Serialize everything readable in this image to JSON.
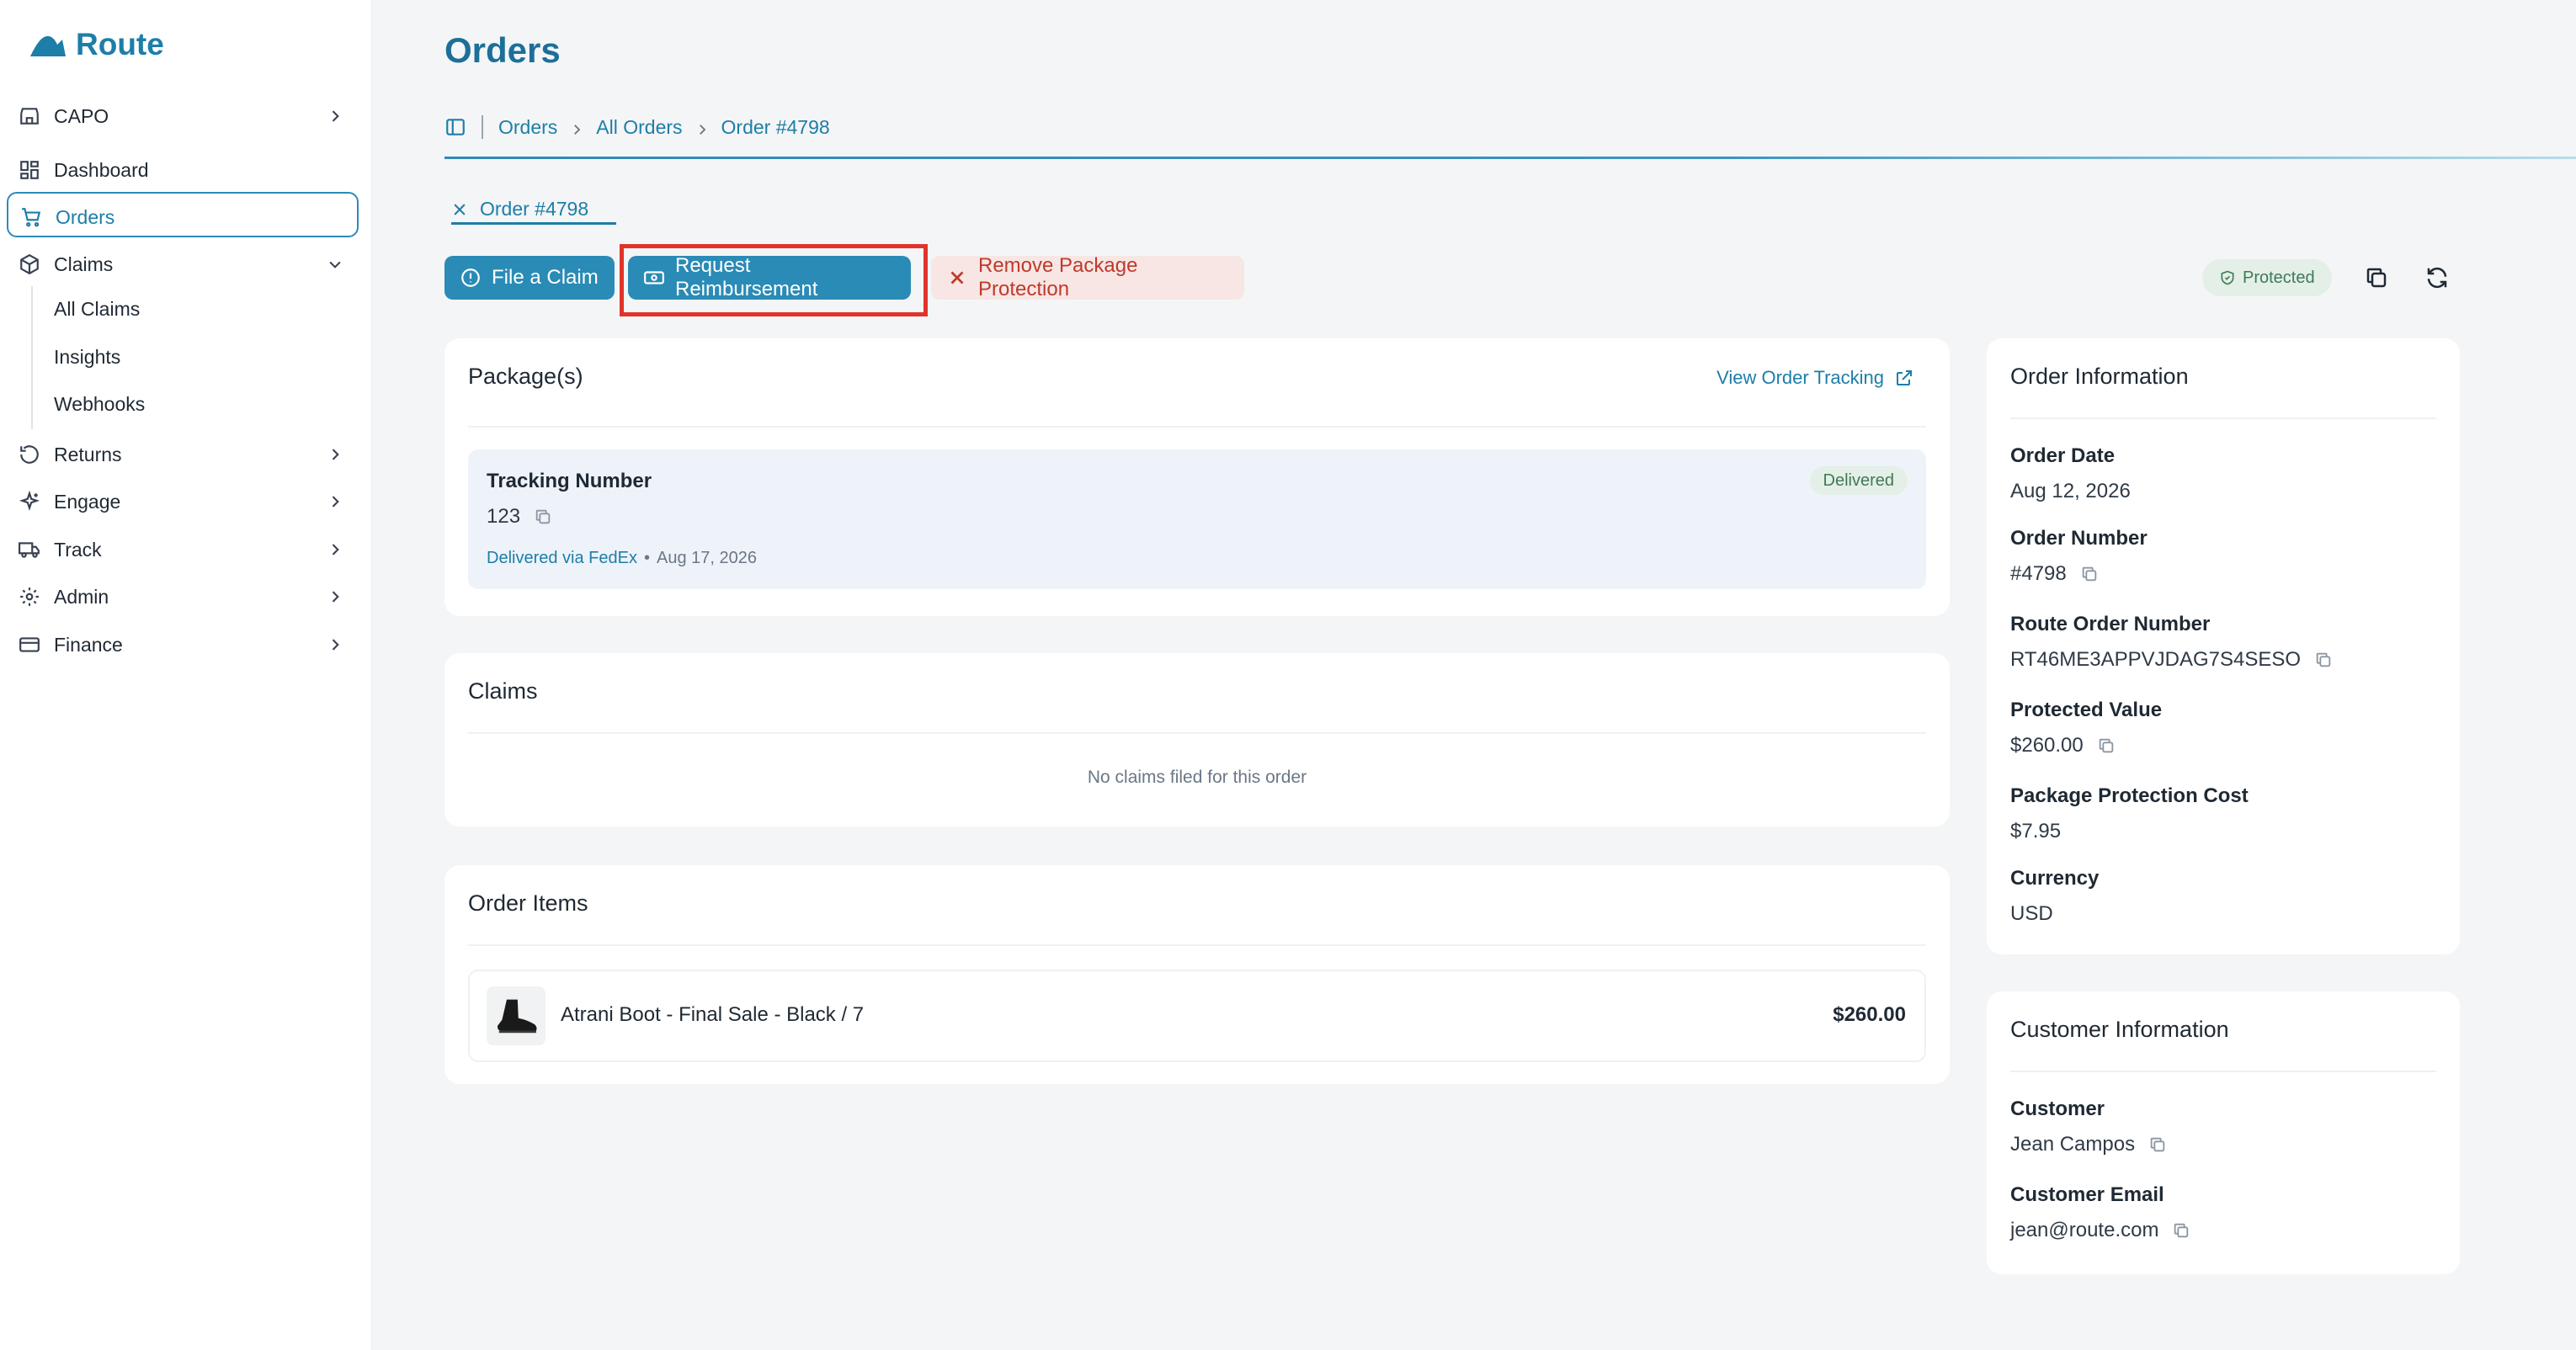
{
  "app": {
    "name": "Route"
  },
  "sidebar": {
    "store": {
      "label": "CAPO"
    },
    "items": [
      {
        "label": "Dashboard"
      },
      {
        "label": "Orders"
      },
      {
        "label": "Claims"
      },
      {
        "label": "Returns"
      },
      {
        "label": "Engage"
      },
      {
        "label": "Track"
      },
      {
        "label": "Admin"
      },
      {
        "label": "Finance"
      }
    ],
    "claims_sub": [
      {
        "label": "All Claims"
      },
      {
        "label": "Insights"
      },
      {
        "label": "Webhooks"
      }
    ]
  },
  "header": {
    "title": "Orders",
    "breadcrumb": [
      "Orders",
      "All Orders",
      "Order #4798"
    ]
  },
  "tab": {
    "label": "Order #4798"
  },
  "actions": {
    "file_claim": "File a Claim",
    "request_reimbursement": "Request Reimbursement",
    "remove_protection": "Remove Package Protection",
    "status_badge": "Protected"
  },
  "packages": {
    "title": "Package(s)",
    "tracking_link": "View Order Tracking",
    "tracking_label": "Tracking Number",
    "tracking_number": "123",
    "status": "Delivered",
    "carrier_text": "Delivered via FedEx",
    "separator": "•",
    "delivered_date": "Aug 17, 2026"
  },
  "claims": {
    "title": "Claims",
    "empty_text": "No claims filed for this order"
  },
  "order_items": {
    "title": "Order Items",
    "items": [
      {
        "name": "Atrani Boot - Final Sale - Black / 7",
        "price": "$260.00"
      }
    ]
  },
  "order_info": {
    "title": "Order Information",
    "fields": [
      {
        "label": "Order Date",
        "value": "Aug 12, 2026"
      },
      {
        "label": "Order Number",
        "value": "#4798"
      },
      {
        "label": "Route Order Number",
        "value": "RT46ME3APPVJDAG7S4SESO"
      },
      {
        "label": "Protected Value",
        "value": "$260.00"
      },
      {
        "label": "Package Protection Cost",
        "value": "$7.95"
      },
      {
        "label": "Currency",
        "value": "USD"
      }
    ]
  },
  "customer_info": {
    "title": "Customer Information",
    "fields": [
      {
        "label": "Customer",
        "value": "Jean Campos"
      },
      {
        "label": "Customer Email",
        "value": "jean@route.com"
      }
    ]
  },
  "colors": {
    "brand": "#1d7ea8",
    "primary_button": "#2a8bb6",
    "danger_text": "#c0392b",
    "highlight": "#e0342a",
    "delivered_badge": "#e3efe7"
  }
}
